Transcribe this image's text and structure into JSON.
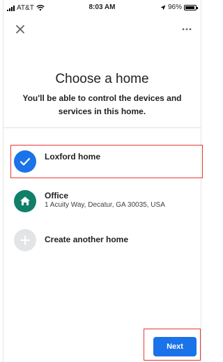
{
  "status_bar": {
    "carrier": "AT&T",
    "time": "8:03 AM",
    "battery": "96%",
    "battery_level": 0.96,
    "icons": [
      "signal-icon",
      "wifi-icon",
      "location-arrow-icon",
      "battery-icon"
    ]
  },
  "header": {
    "close_icon": "close-icon",
    "more_icon": "more-options-icon"
  },
  "page": {
    "title": "Choose a home",
    "subtitle": "You'll be able to control the devices and services in this home."
  },
  "homes": [
    {
      "name": "Loxford home",
      "selected": true,
      "icon": "check-icon",
      "color": "#1a73e8"
    },
    {
      "name": "Office",
      "address": "1 Acuity Way, Decatur, GA 30035, USA",
      "icon": "home-icon",
      "color": "#11806a"
    }
  ],
  "create": {
    "label": "Create another home",
    "icon": "plus-icon",
    "color": "#e3e4e6"
  },
  "footer": {
    "next_label": "Next"
  },
  "colors": {
    "accent": "#1a73e8",
    "highlight": "#e53935",
    "office_green": "#11806a"
  }
}
